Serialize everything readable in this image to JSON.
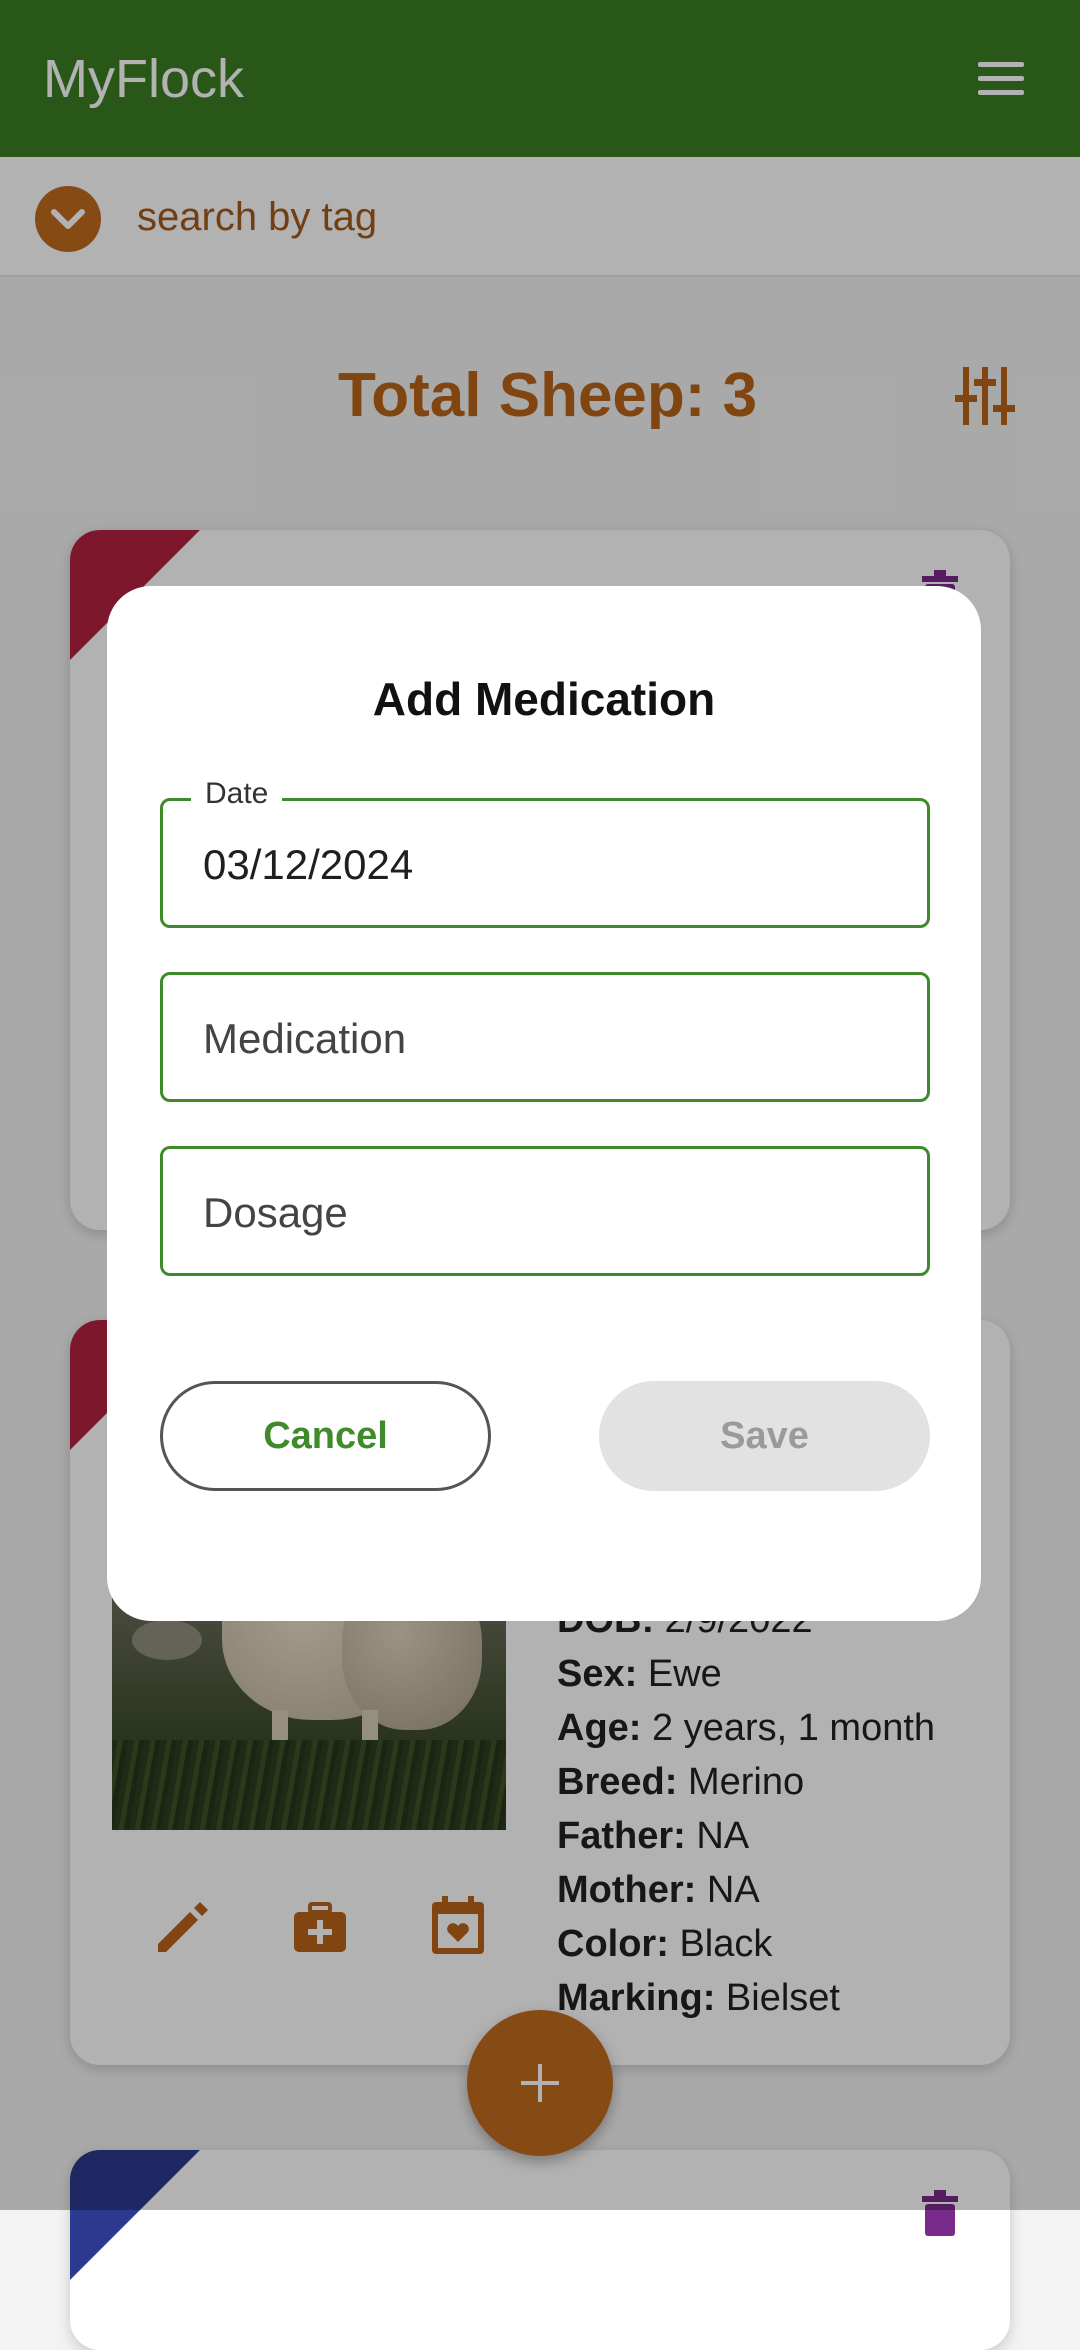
{
  "app": {
    "title": "MyFlock"
  },
  "search": {
    "placeholder": "search by tag"
  },
  "summary": {
    "total_text": "Total Sheep: 3"
  },
  "sheep_card": {
    "details": [
      {
        "label": "DOB:",
        "value": "2/9/2022"
      },
      {
        "label": "Sex:",
        "value": "Ewe"
      },
      {
        "label": "Age:",
        "value": "2 years, 1 month"
      },
      {
        "label": "Breed:",
        "value": "Merino"
      },
      {
        "label": "Father:",
        "value": "NA"
      },
      {
        "label": "Mother:",
        "value": "NA"
      },
      {
        "label": "Color:",
        "value": "Black"
      },
      {
        "label": "Marking:",
        "value": "Bielset"
      }
    ]
  },
  "dialog": {
    "title": "Add Medication",
    "date_label": "Date",
    "date_value": "03/12/2024",
    "medication_placeholder": "Medication",
    "dosage_placeholder": "Dosage",
    "cancel_label": "Cancel",
    "save_label": "Save"
  },
  "colors": {
    "appbar": "#3a7d22",
    "accent_brown": "#c16a1f",
    "field_border": "#3f8a2a",
    "sex_tag_female": "#b3233f",
    "sex_tag_male": "#2b3a8f",
    "delete_purple": "#7a2a8a"
  }
}
